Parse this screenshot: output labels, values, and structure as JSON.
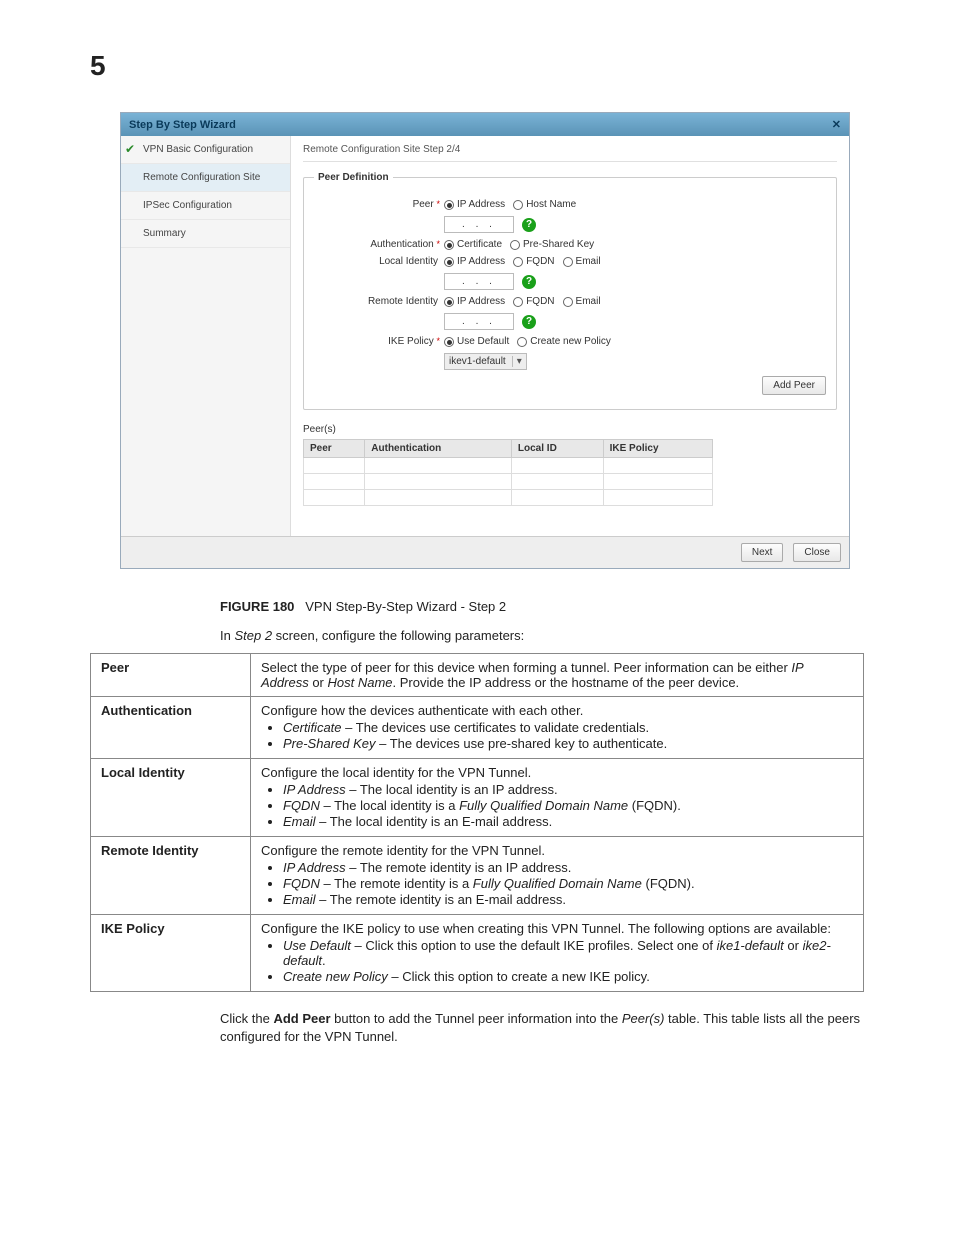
{
  "page_number": "5",
  "wizard": {
    "title": "Step By Step Wizard",
    "sidebar": [
      {
        "label": "VPN Basic Configuration",
        "checked": true
      },
      {
        "label": "Remote Configuration Site",
        "active": true
      },
      {
        "label": "IPSec Configuration"
      },
      {
        "label": "Summary"
      }
    ],
    "header": "Remote Configuration Site  Step 2/4",
    "peer_definition_legend": "Peer Definition",
    "rows": {
      "peer_label": "Peer",
      "peer_star": "*",
      "peer_opt_ip": "IP Address",
      "peer_opt_host": "Host Name",
      "ip_dots": ".   .   .",
      "auth_label": "Authentication",
      "auth_star": "*",
      "auth_cert": "Certificate",
      "auth_psk": "Pre-Shared Key",
      "local_label": "Local Identity",
      "local_ip": "IP Address",
      "local_fqdn": "FQDN",
      "local_email": "Email",
      "remote_label": "Remote Identity",
      "remote_ip": "IP Address",
      "remote_fqdn": "FQDN",
      "remote_email": "Email",
      "ike_label": "IKE Policy",
      "ike_star": "*",
      "ike_usedef": "Use Default",
      "ike_create": "Create new Policy",
      "ike_select_value": "ikev1-default"
    },
    "buttons": {
      "add_peer": "Add Peer",
      "next": "Next",
      "close": "Close"
    },
    "peers_label": "Peer(s)",
    "peers_columns": [
      "Peer",
      "Authentication",
      "Local ID",
      "IKE Policy"
    ]
  },
  "figure_caption_num": "FIGURE 180",
  "figure_caption_text": "VPN Step-By-Step Wizard - Step 2",
  "intro_text_prefix": "In ",
  "intro_text_em": "Step 2",
  "intro_text_suffix": " screen, configure the following parameters:",
  "params": {
    "peer": {
      "name": "Peer",
      "text_a": "Select the type of peer for this device when forming a tunnel. Peer information can be either ",
      "em1": "IP Address",
      "text_b": " or ",
      "em2": "Host Name",
      "text_c": ". Provide the IP address or the hostname of the peer device."
    },
    "auth": {
      "name": "Authentication",
      "intro": "Configure how the devices authenticate with each other.",
      "li1_em": "Certificate",
      "li1_rest": " – The devices use certificates to validate credentials.",
      "li2_em": "Pre-Shared Key",
      "li2_rest": " – The devices use pre-shared key to authenticate."
    },
    "local": {
      "name": "Local Identity",
      "intro": "Configure the local identity for the VPN Tunnel.",
      "li1_em": "IP Address",
      "li1_rest": " – The local identity is an IP address.",
      "li2_em": "FQDN",
      "li2_rest_a": " – The local identity is a ",
      "li2_rest_em": "Fully Qualified Domain Name",
      "li2_rest_b": " (FQDN).",
      "li3_em": "Email",
      "li3_rest": " – The local identity is an E-mail address."
    },
    "remote": {
      "name": "Remote Identity",
      "intro": "Configure the remote identity for the VPN Tunnel.",
      "li1_em": "IP Address",
      "li1_rest": " – The remote identity is an IP address.",
      "li2_em": "FQDN",
      "li2_rest_a": " – The remote identity is a ",
      "li2_rest_em": "Fully Qualified Domain Name",
      "li2_rest_b": " (FQDN).",
      "li3_em": "Email",
      "li3_rest": " – The remote identity is an E-mail address."
    },
    "ike": {
      "name": "IKE Policy",
      "intro": "Configure the IKE policy to use when creating this VPN Tunnel. The following options are available:",
      "li1_em": "Use Default",
      "li1_a": " – Click this option to use the default IKE profiles. Select one of ",
      "li1_em2": "ike1-default",
      "li1_b": " or ",
      "li1_em3": "ike2-default",
      "li1_c": ".",
      "li2_em": "Create new Policy",
      "li2_rest": " – Click this option to create a new IKE policy."
    }
  },
  "closing": {
    "a": "Click the ",
    "bold": "Add Peer",
    "b": " button to add the Tunnel peer information into the ",
    "em": "Peer(s)",
    "c": " table. This table lists all the peers configured for the VPN Tunnel."
  }
}
